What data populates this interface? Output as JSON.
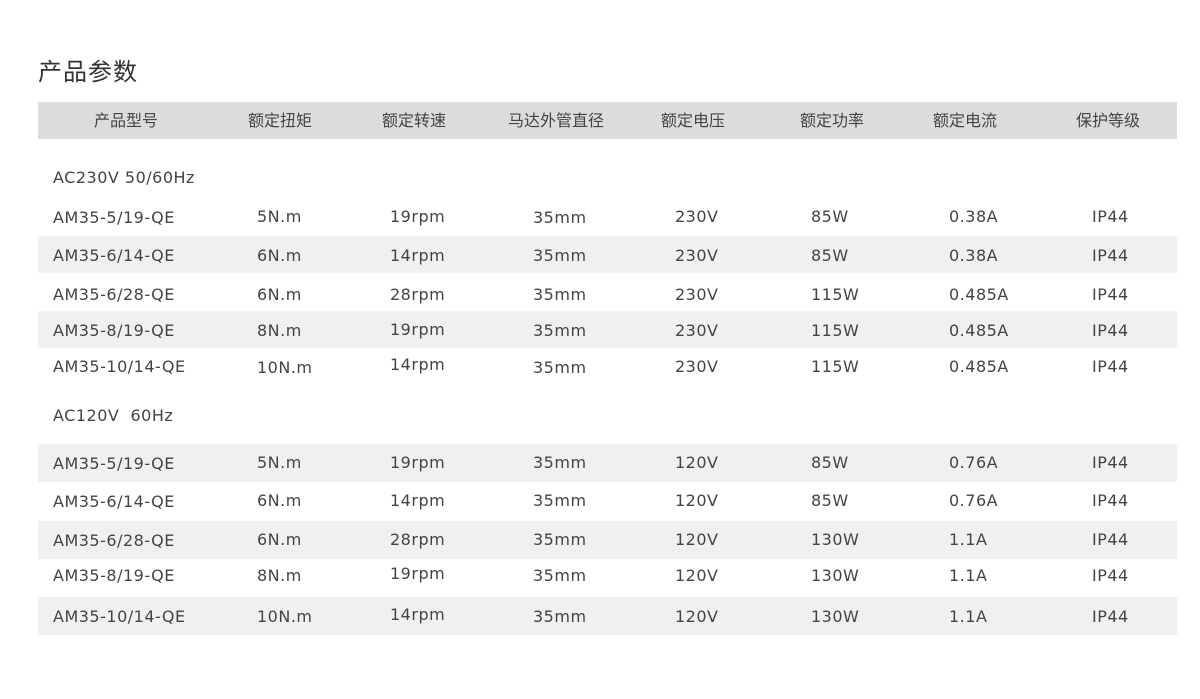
{
  "title": "产品参数",
  "columns": [
    "产品型号",
    "额定扭矩",
    "额定转速",
    "马达外管直径",
    "额定电压",
    "额定功率",
    "额定电流",
    "保护等级"
  ],
  "groups": [
    {
      "label": "AC230V 50/60Hz",
      "rows": [
        [
          "AM35-5/19-QE",
          "5N.m",
          "19rpm",
          "35mm",
          "230V",
          "85W",
          "0.38A",
          "IP44"
        ],
        [
          "AM35-6/14-QE",
          "6N.m",
          "14rpm",
          "35mm",
          "230V",
          "85W",
          "0.38A",
          "IP44"
        ],
        [
          "AM35-6/28-QE",
          "6N.m",
          "28rpm",
          "35mm",
          "230V",
          "115W",
          "0.485A",
          "IP44"
        ],
        [
          "AM35-8/19-QE",
          "8N.m",
          "19rpm",
          "35mm",
          "230V",
          "115W",
          "0.485A",
          "IP44"
        ],
        [
          "AM35-10/14-QE",
          "10N.m",
          "14rpm",
          "35mm",
          "230V",
          "115W",
          "0.485A",
          "IP44"
        ]
      ]
    },
    {
      "label": "AC120V  60Hz",
      "rows": [
        [
          "AM35-5/19-QE",
          "5N.m",
          "19rpm",
          "35mm",
          "120V",
          "85W",
          "0.76A",
          "IP44"
        ],
        [
          "AM35-6/14-QE",
          "6N.m",
          "14rpm",
          "35mm",
          "120V",
          "85W",
          "0.76A",
          "IP44"
        ],
        [
          "AM35-6/28-QE",
          "6N.m",
          "28rpm",
          "35mm",
          "120V",
          "130W",
          "1.1A",
          "IP44"
        ],
        [
          "AM35-8/19-QE",
          "8N.m",
          "19rpm",
          "35mm",
          "120V",
          "130W",
          "1.1A",
          "IP44"
        ],
        [
          "AM35-10/14-QE",
          "10N.m",
          "14rpm",
          "35mm",
          "120V",
          "130W",
          "1.1A",
          "IP44"
        ]
      ]
    }
  ],
  "colors": {
    "header_bg": "#dcdcdc",
    "row_shade": "#f0f0f0",
    "text": "#444444"
  }
}
